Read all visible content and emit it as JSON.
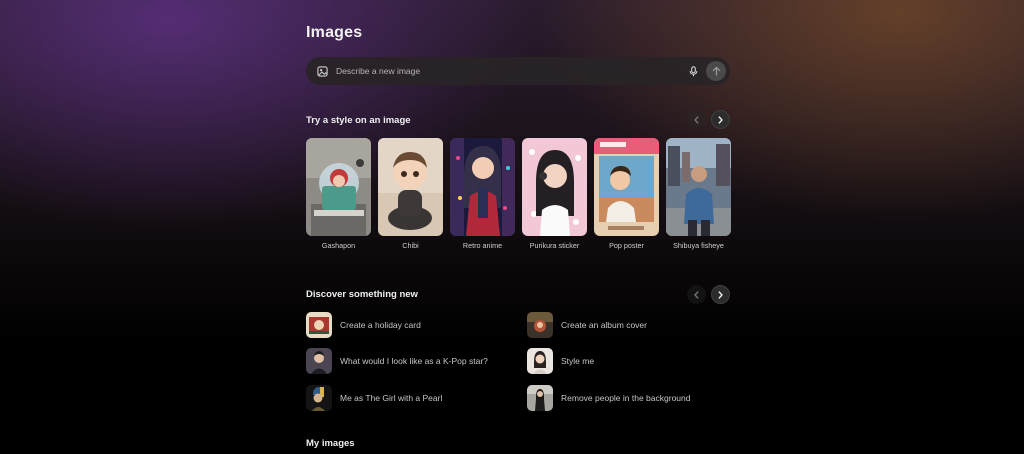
{
  "page": {
    "title": "Images"
  },
  "search": {
    "placeholder": "Describe a new image",
    "image_icon": "image-add-icon",
    "mic_icon": "microphone-icon",
    "send_icon": "arrow-up-icon"
  },
  "styles_section": {
    "title": "Try a style on an image",
    "items": [
      {
        "label": "Gashapon"
      },
      {
        "label": "Chibi"
      },
      {
        "label": "Retro anime"
      },
      {
        "label": "Purikura sticker"
      },
      {
        "label": "Pop poster"
      },
      {
        "label": "Shibuya fisheye"
      }
    ]
  },
  "discover_section": {
    "title": "Discover something new",
    "items": [
      {
        "label": "Create a holiday card"
      },
      {
        "label": "Create an album cover"
      },
      {
        "label": "What would I look like as a K-Pop star?"
      },
      {
        "label": "Style me"
      },
      {
        "label": "Me as The Girl with a Pearl"
      },
      {
        "label": "Remove people in the background"
      }
    ]
  },
  "my_images": {
    "title": "My images"
  },
  "colors": {
    "background_top_left": "#5c3080",
    "background_top_right": "#6e4628",
    "background_bottom": "#000000",
    "text": "#ececec"
  }
}
